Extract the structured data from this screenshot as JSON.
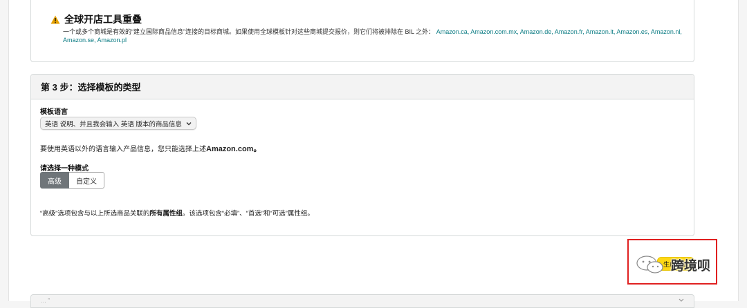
{
  "notice": {
    "title": "全球开店工具重叠",
    "text": "一个或多个商城是有效的“建立国际商品信息”连接的目标商城。如果使用全球模板针对这些商城提交报价，则它们将被排除在 BIL 之外：",
    "marketplaces": "Amazon.ca, Amazon.com.mx, Amazon.de, Amazon.fr, Amazon.it, Amazon.es, Amazon.nl, Amazon.se, Amazon.pl"
  },
  "step": {
    "title": "第 3 步：选择模板的类型",
    "language_label": "模板语言",
    "language_selected": "英语 说明、并且我会输入 英语 版本的商品信息",
    "note_prefix": "要使用英语以外的语言输入产品信息，您只能选择上述",
    "note_bold": "Amazon.com。",
    "mode_label": "请选择一种模式",
    "modes": [
      "高级",
      "自定义"
    ],
    "desc_prefix": "“高级”选项包含与以上所选商品关联的",
    "desc_bold": "所有属性组",
    "desc_suffix": "。该选项包含“必填”、“首选”和“可选”属性组。"
  },
  "next_button": "生成模板",
  "bottom_section": "… ”",
  "watermark": "跨境呗",
  "colors": {
    "accent_link": "#0a7b83",
    "primary_button": "#ffd814",
    "highlight": "#e02020",
    "segment_active": "#6f7579"
  }
}
